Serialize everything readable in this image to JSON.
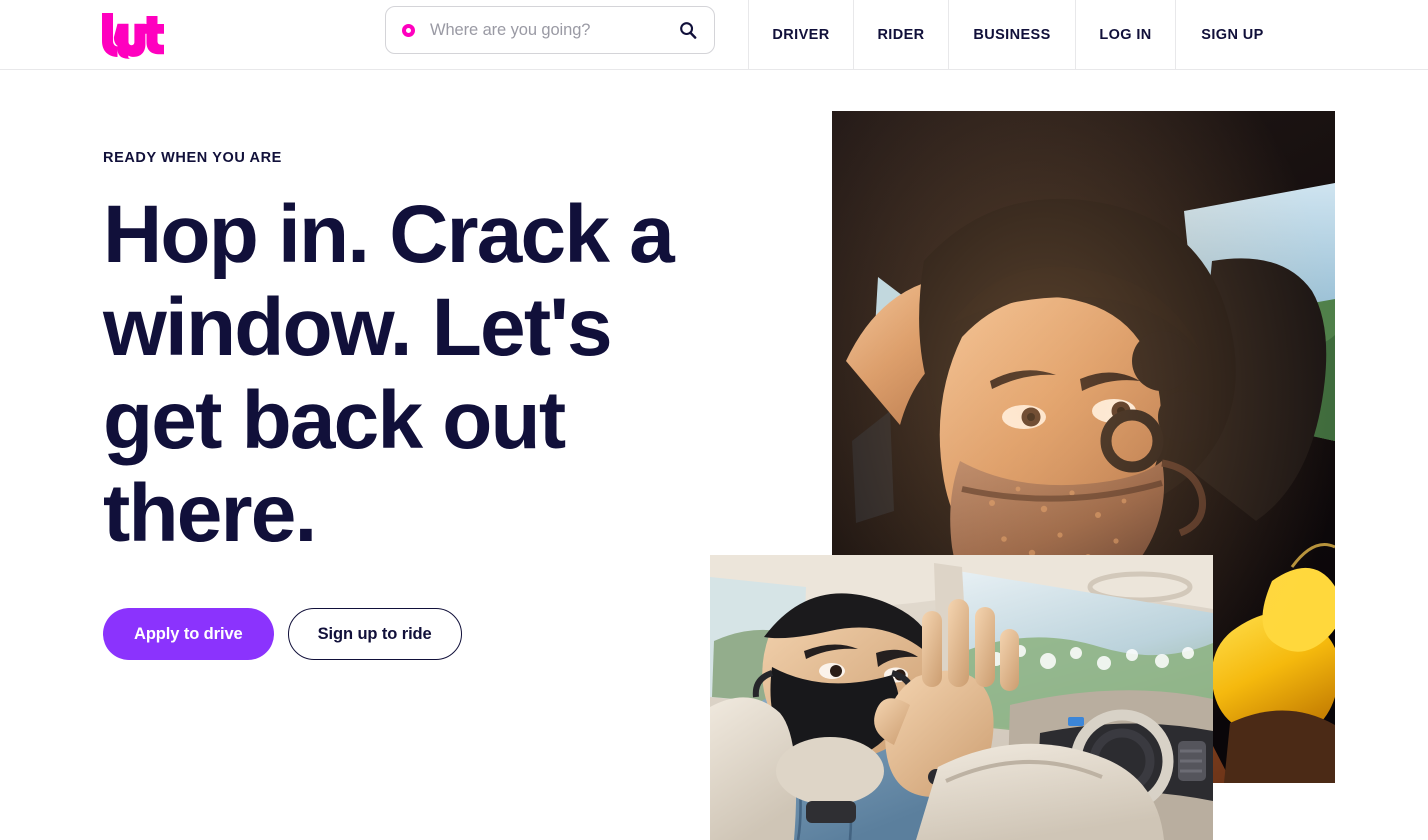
{
  "brand": {
    "name": "Lyft",
    "logo_color": "#ff00bf",
    "accent_purple": "#8b33fd",
    "text_navy": "#11103a"
  },
  "header": {
    "logo_label": "lyft",
    "search": {
      "placeholder": "Where are you going?",
      "value": "",
      "pin_icon": "location-pin-icon",
      "submit_icon": "search-icon"
    },
    "nav": [
      {
        "label": "DRIVER"
      },
      {
        "label": "RIDER"
      },
      {
        "label": "BUSINESS"
      },
      {
        "label": "LOG IN"
      },
      {
        "label": "SIGN UP"
      }
    ]
  },
  "hero": {
    "eyebrow": "READY WHEN YOU ARE",
    "headline": "Hop in. Crack a window. Let's get back out there.",
    "primary_cta": "Apply to drive",
    "secondary_cta": "Sign up to ride",
    "image_main_alt": "Person with curly hair wearing a patterned face mask riding in a car at golden hour",
    "image_inset_alt": "Driver in a denim shirt wearing a black face mask waving from the front seat of a car"
  }
}
